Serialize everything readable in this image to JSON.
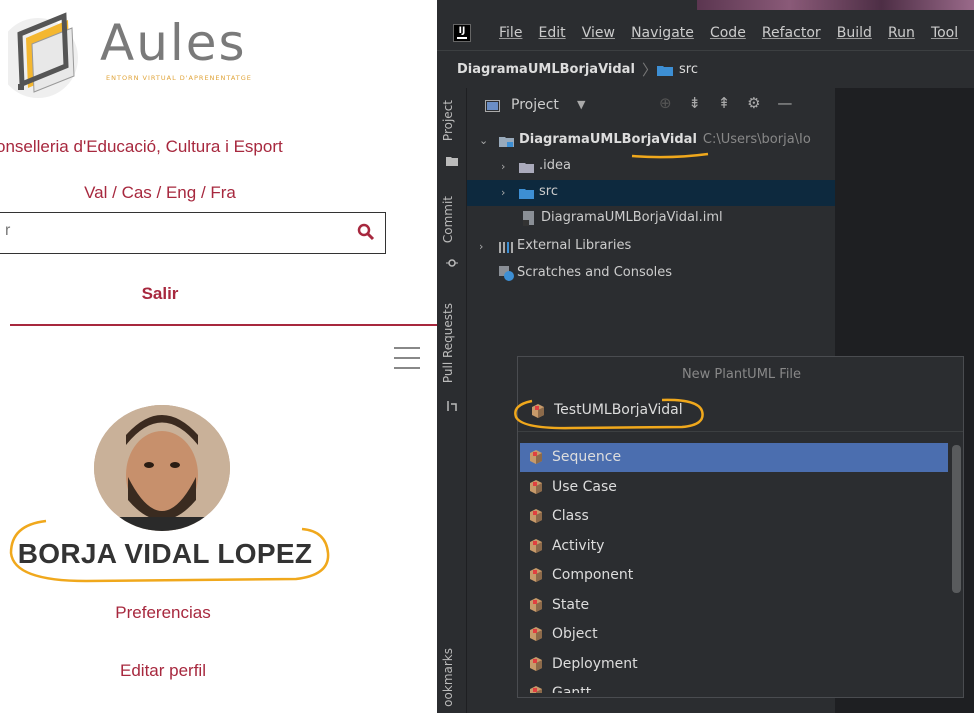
{
  "web": {
    "logo": {
      "title": "Aules",
      "subtitle": "ENTORN VIRTUAL D'APRENENTATGE"
    },
    "conselleria": "onselleria d'Educació, Cultura i Esport",
    "languages": "Val / Cas / Eng / Fra",
    "search": {
      "value": "r"
    },
    "logout": "Salir",
    "user_name": "BORJA VIDAL LOPEZ",
    "preferences": "Preferencias",
    "edit_profile": "Editar perfil"
  },
  "ide": {
    "logo": "IJ",
    "menu": [
      "File",
      "Edit",
      "View",
      "Navigate",
      "Code",
      "Refactor",
      "Build",
      "Run",
      "Tool"
    ],
    "breadcrumb": {
      "project": "DiagramaUMLBorjaVidal",
      "folder": "src"
    },
    "side_tabs": {
      "project": "Project",
      "commit": "Commit",
      "pull_requests": "Pull Requests",
      "bookmarks": "ookmarks"
    },
    "panel_title": "Project",
    "tree": [
      {
        "label": "DiagramaUMLBorjaVidal",
        "path": "C:\\Users\\borja\\Io"
      },
      {
        "label": ".idea"
      },
      {
        "label": "src"
      },
      {
        "label": "DiagramaUMLBorjaVidal.iml"
      },
      {
        "label": "External Libraries"
      },
      {
        "label": "Scratches and Consoles"
      }
    ],
    "popup": {
      "title": "New PlantUML File",
      "name_value": "TestUMLBorjaVidal",
      "options": [
        "Sequence",
        "Use Case",
        "Class",
        "Activity",
        "Component",
        "State",
        "Object",
        "Deployment",
        "Gantt"
      ],
      "selected": "Sequence"
    },
    "colors": {
      "accent_red": "#a7283e",
      "selection_blue": "#4b6eaf",
      "annotation_orange": "#f0a81c",
      "folder_blue": "#3d8fd4"
    }
  }
}
